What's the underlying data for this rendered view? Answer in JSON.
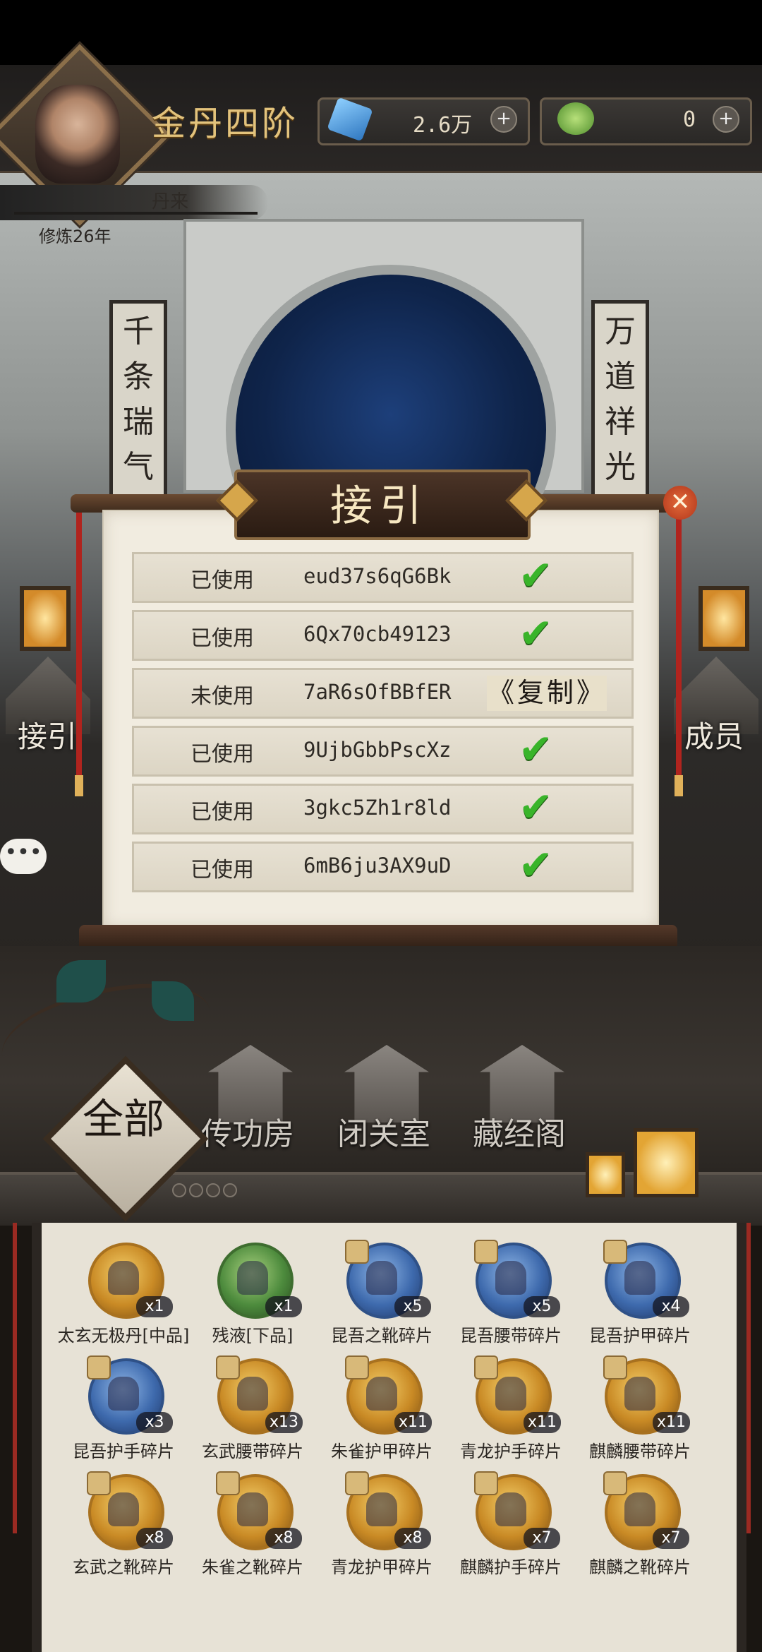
{
  "header": {
    "rank_title": "金丹四阶",
    "resources": [
      {
        "icon": "spirit-stone-icon",
        "value": "2.6万"
      },
      {
        "icon": "jade-icon",
        "value": "0"
      }
    ],
    "character_name": "丹来",
    "cultivation": "修炼26年",
    "plus": "+"
  },
  "scene": {
    "couplet_left": "千条瑞气",
    "couplet_right": "万道祥光",
    "left_building_label": "接引",
    "right_building_label": "成员",
    "chat_glyph": "•••"
  },
  "modal": {
    "title": "接引",
    "close_glyph": "✕",
    "rows": [
      {
        "status": "已使用",
        "code": "eud37s6qG6Bk",
        "action": "check"
      },
      {
        "status": "已使用",
        "code": "6Qx70cb49123",
        "action": "check"
      },
      {
        "status": "未使用",
        "code": "7aR6sOfBBfER",
        "action": "copy",
        "action_label": "《复制》"
      },
      {
        "status": "已使用",
        "code": "9UjbGbbPscXz",
        "action": "check"
      },
      {
        "status": "已使用",
        "code": "3gkc5Zh1r8ld",
        "action": "check"
      },
      {
        "status": "已使用",
        "code": "6mB6ju3AX9uD",
        "action": "check"
      }
    ],
    "check_glyph": "✔"
  },
  "buildings": [
    {
      "label": "传功房",
      "icon": "pavilion-icon"
    },
    {
      "label": "闭关室",
      "icon": "temple-icon"
    },
    {
      "label": "藏经阁",
      "icon": "library-icon"
    }
  ],
  "tab": {
    "label": "全部"
  },
  "inventory": [
    {
      "name": "太玄无极丹[中品]",
      "qty": "x1",
      "style": "gold",
      "fragment": false
    },
    {
      "name": "残液[下品]",
      "qty": "x1",
      "style": "green",
      "fragment": false
    },
    {
      "name": "昆吾之靴碎片",
      "qty": "x5",
      "style": "blue",
      "fragment": true
    },
    {
      "name": "昆吾腰带碎片",
      "qty": "x5",
      "style": "blue",
      "fragment": true
    },
    {
      "name": "昆吾护甲碎片",
      "qty": "x4",
      "style": "blue",
      "fragment": true
    },
    {
      "name": "昆吾护手碎片",
      "qty": "x3",
      "style": "blue",
      "fragment": true
    },
    {
      "name": "玄武腰带碎片",
      "qty": "x13",
      "style": "gold",
      "fragment": true
    },
    {
      "name": "朱雀护甲碎片",
      "qty": "x11",
      "style": "gold",
      "fragment": true
    },
    {
      "name": "青龙护手碎片",
      "qty": "x11",
      "style": "gold",
      "fragment": true
    },
    {
      "name": "麒麟腰带碎片",
      "qty": "x11",
      "style": "gold",
      "fragment": true
    },
    {
      "name": "玄武之靴碎片",
      "qty": "x8",
      "style": "gold",
      "fragment": true
    },
    {
      "name": "朱雀之靴碎片",
      "qty": "x8",
      "style": "gold",
      "fragment": true
    },
    {
      "name": "青龙护甲碎片",
      "qty": "x8",
      "style": "gold",
      "fragment": true
    },
    {
      "name": "麒麟护手碎片",
      "qty": "x7",
      "style": "gold",
      "fragment": true
    },
    {
      "name": "麒麟之靴碎片",
      "qty": "x7",
      "style": "gold",
      "fragment": true
    }
  ]
}
